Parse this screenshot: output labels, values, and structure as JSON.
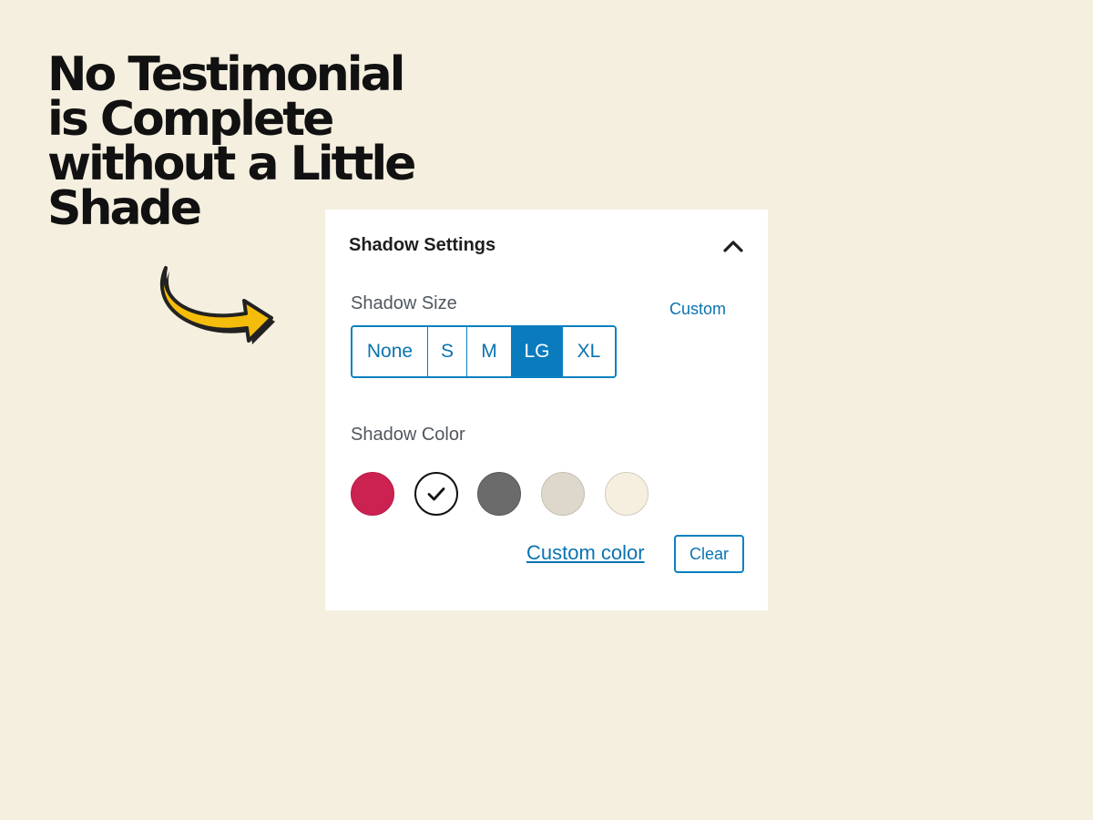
{
  "headline": {
    "lines": [
      "No Testimonial",
      "is Complete",
      "without a Little",
      "Shade"
    ]
  },
  "arrow": {
    "icon": "curved-arrow-icon",
    "fill_color": "#f5bd0b",
    "outline_color": "#222222"
  },
  "panel": {
    "title": "Shadow Settings",
    "toggle_icon": "chevron-up-icon",
    "shadow_size": {
      "label": "Shadow Size",
      "custom_link": "Custom",
      "options": [
        "None",
        "S",
        "M",
        "LG",
        "XL"
      ],
      "selected": "LG",
      "accent_color": "#0a7cbe"
    },
    "shadow_color": {
      "label": "Shadow Color",
      "swatches": [
        {
          "name": "crimson",
          "color": "#cc2252",
          "selected": false
        },
        {
          "name": "black",
          "color": "#000000",
          "selected": true
        },
        {
          "name": "gray",
          "color": "#6b6b6b",
          "selected": false
        },
        {
          "name": "light-taupe",
          "color": "#ddd8cb",
          "selected": false
        },
        {
          "name": "cream",
          "color": "#f6efe0",
          "selected": false
        }
      ],
      "selected_icon": "checkmark-icon",
      "custom_color_link": "Custom color",
      "clear_button": "Clear"
    }
  }
}
